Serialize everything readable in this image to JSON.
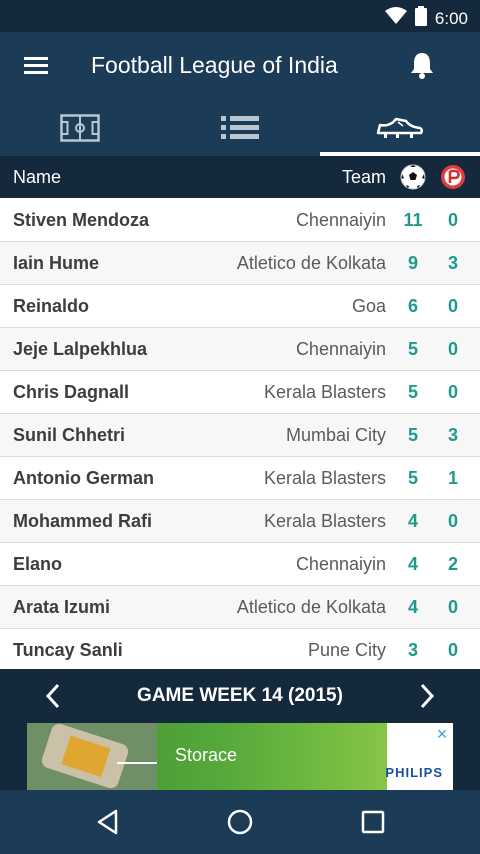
{
  "status_bar": {
    "time": "6:00",
    "icons": [
      "wifi-icon",
      "battery-icon"
    ]
  },
  "app_bar": {
    "title": "Football League of India",
    "menu_icon": "menu-icon",
    "notification_icon": "bell-icon"
  },
  "tabs": [
    {
      "icon": "pitch-icon",
      "active": false
    },
    {
      "icon": "standings-list-icon",
      "active": false
    },
    {
      "icon": "football-boot-icon",
      "active": true
    }
  ],
  "table": {
    "header": {
      "name": "Name",
      "team": "Team",
      "goals_icon": "football-icon",
      "penalties_icon": "penalty-icon"
    },
    "rows": [
      {
        "name": "Stiven Mendoza",
        "team": "Chennaiyin",
        "goals": "11",
        "penalties": "0"
      },
      {
        "name": "Iain Hume",
        "team": "Atletico de Kolkata",
        "goals": "9",
        "penalties": "3"
      },
      {
        "name": "Reinaldo",
        "team": "Goa",
        "goals": "6",
        "penalties": "0"
      },
      {
        "name": "Jeje Lalpekhlua",
        "team": "Chennaiyin",
        "goals": "5",
        "penalties": "0"
      },
      {
        "name": "Chris Dagnall",
        "team": "Kerala Blasters",
        "goals": "5",
        "penalties": "0"
      },
      {
        "name": "Sunil Chhetri",
        "team": "Mumbai City",
        "goals": "5",
        "penalties": "3"
      },
      {
        "name": "Antonio German",
        "team": "Kerala Blasters",
        "goals": "5",
        "penalties": "1"
      },
      {
        "name": "Mohammed Rafi",
        "team": "Kerala Blasters",
        "goals": "4",
        "penalties": "0"
      },
      {
        "name": "Elano",
        "team": "Chennaiyin",
        "goals": "4",
        "penalties": "2"
      },
      {
        "name": "Arata Izumi",
        "team": "Atletico de Kolkata",
        "goals": "4",
        "penalties": "0"
      },
      {
        "name": "Tuncay Sanli",
        "team": "Pune City",
        "goals": "3",
        "penalties": "0"
      }
    ]
  },
  "game_week": {
    "label": "GAME WEEK 14 (2015)",
    "prev_icon": "chevron-left-icon",
    "next_icon": "chevron-right-icon"
  },
  "ad": {
    "text": "Storace",
    "brand": "PHILIPS",
    "close_label": "×"
  },
  "nav_bar": {
    "icons": [
      "back-icon",
      "home-icon",
      "recents-icon"
    ]
  },
  "colors": {
    "status_bar": "#15293d",
    "app_bar": "#1b3b57",
    "accent_number": "#1e9a8c",
    "row_alt": "#f7f7f7",
    "text_dark": "#3d3d3d",
    "text_muted": "#5b5b5b"
  }
}
